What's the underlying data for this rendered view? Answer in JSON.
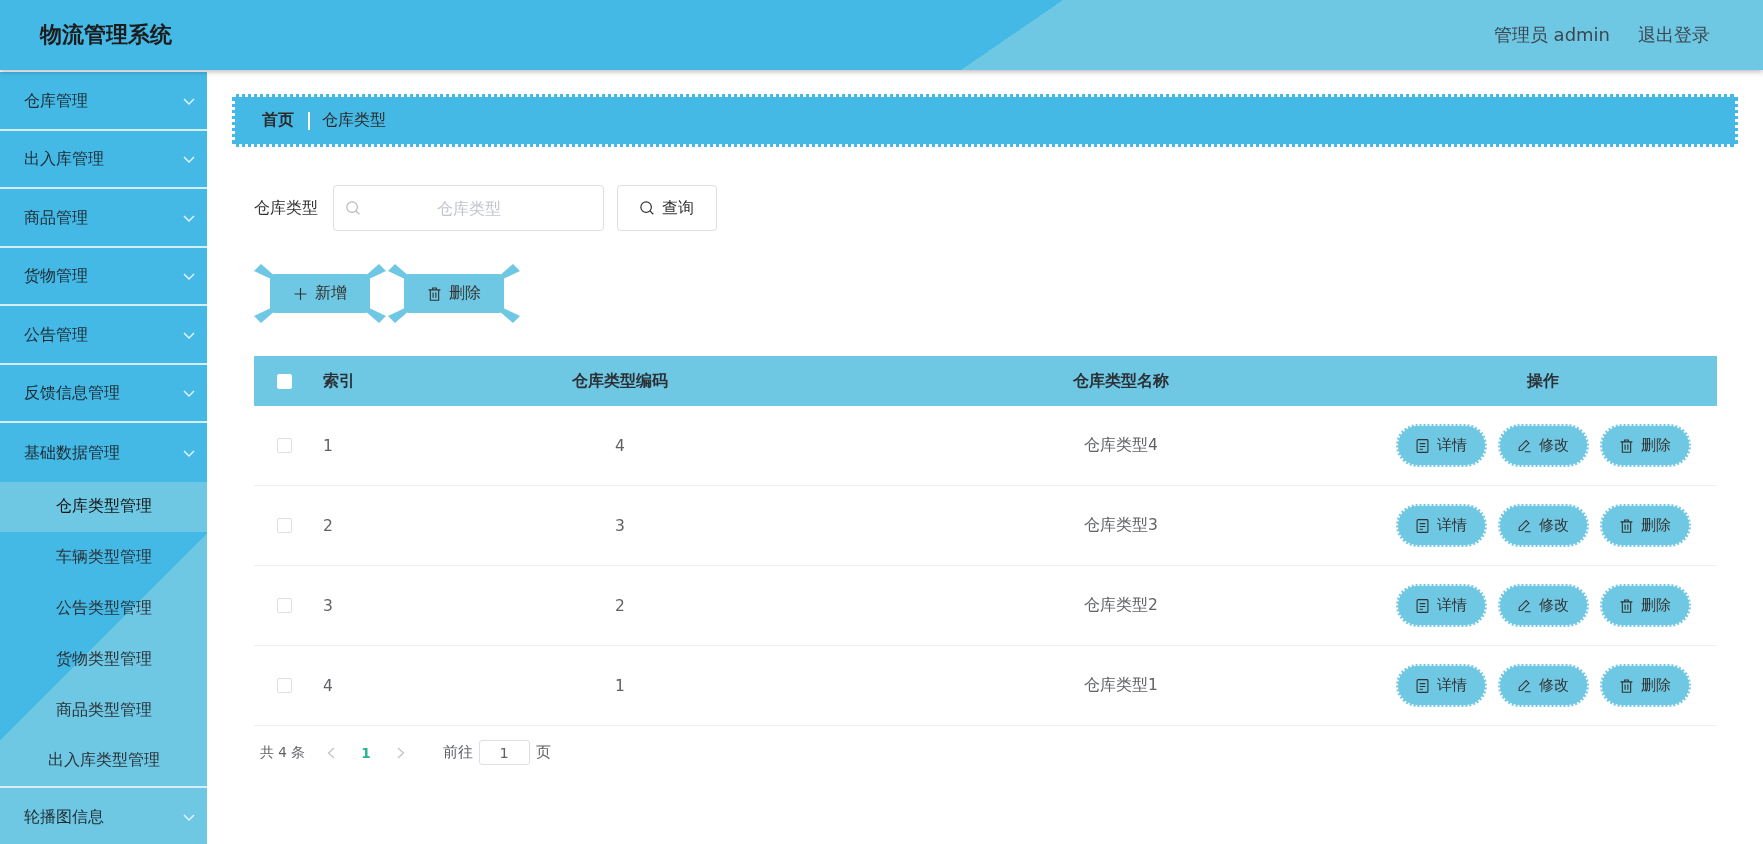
{
  "header": {
    "title": "物流管理系统",
    "user": "管理员 admin",
    "logout": "退出登录"
  },
  "sidebar": {
    "items": [
      {
        "label": "仓库管理"
      },
      {
        "label": "出入库管理"
      },
      {
        "label": "商品管理"
      },
      {
        "label": "货物管理"
      },
      {
        "label": "公告管理"
      },
      {
        "label": "反馈信息管理"
      },
      {
        "label": "基础数据管理",
        "children": [
          {
            "label": "仓库类型管理",
            "selected": true
          },
          {
            "label": "车辆类型管理",
            "selected": false
          },
          {
            "label": "公告类型管理",
            "selected": false
          },
          {
            "label": "货物类型管理",
            "selected": false
          },
          {
            "label": "商品类型管理",
            "selected": false
          },
          {
            "label": "出入库类型管理",
            "selected": false
          }
        ]
      },
      {
        "label": "轮播图信息"
      }
    ]
  },
  "breadcrumb": [
    {
      "label": "首页"
    },
    {
      "label": "仓库类型"
    }
  ],
  "search": {
    "label": "仓库类型",
    "placeholder": "仓库类型",
    "button": "查询"
  },
  "toolbar": [
    {
      "kind": "add",
      "label": "新增"
    },
    {
      "kind": "delete",
      "label": "删除"
    }
  ],
  "table": {
    "select_all_checked": false,
    "columns": [
      "索引",
      "仓库类型编码",
      "仓库类型名称",
      "操作"
    ],
    "rows": [
      {
        "checked": false,
        "cells": [
          "1",
          "4",
          "仓库类型4"
        ],
        "actions": [
          {
            "kind": "detail",
            "label": "详情"
          },
          {
            "kind": "edit",
            "label": "修改"
          },
          {
            "kind": "delete",
            "label": "删除"
          }
        ]
      },
      {
        "checked": false,
        "cells": [
          "2",
          "3",
          "仓库类型3"
        ],
        "actions": [
          {
            "kind": "detail",
            "label": "详情"
          },
          {
            "kind": "edit",
            "label": "修改"
          },
          {
            "kind": "delete",
            "label": "删除"
          }
        ]
      },
      {
        "checked": false,
        "cells": [
          "3",
          "2",
          "仓库类型2"
        ],
        "actions": [
          {
            "kind": "detail",
            "label": "详情"
          },
          {
            "kind": "edit",
            "label": "修改"
          },
          {
            "kind": "delete",
            "label": "删除"
          }
        ]
      },
      {
        "checked": false,
        "cells": [
          "4",
          "1",
          "仓库类型1"
        ],
        "actions": [
          {
            "kind": "detail",
            "label": "详情"
          },
          {
            "kind": "edit",
            "label": "修改"
          },
          {
            "kind": "delete",
            "label": "删除"
          }
        ]
      }
    ]
  },
  "pagination": {
    "total": "共 4 条",
    "pages": [
      {
        "label": "1",
        "selected": true
      }
    ],
    "goto_label": "前往",
    "goto_value": "1",
    "suffix": "页"
  }
}
